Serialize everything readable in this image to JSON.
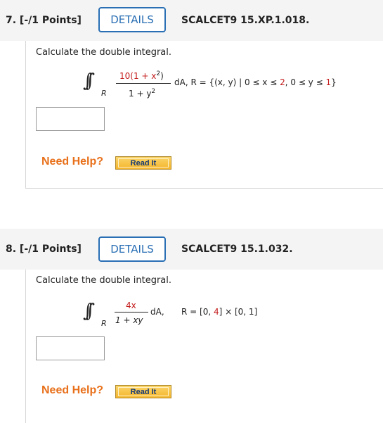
{
  "questions": [
    {
      "number": "7. [-/1 Points]",
      "details_label": "DETAILS",
      "code": "SCALCET9 15.XP.1.018.",
      "prompt": "Calculate the double integral.",
      "int_subscript": "R",
      "numerator_pre": "10(1 + x",
      "numerator_exp": "2",
      "numerator_post": ")",
      "denominator_pre": "1 + y",
      "denominator_exp": "2",
      "tail_pre": "dA, R = {(x, y) | 0 ≤ x ≤ ",
      "tail_red1": "2",
      "tail_mid": ", 0 ≤ y ≤ ",
      "tail_red2": "1",
      "tail_post": "}",
      "answer_value": "",
      "need_help": "Need Help?",
      "read_it": "Read It"
    },
    {
      "number": "8. [-/1 Points]",
      "details_label": "DETAILS",
      "code": "SCALCET9 15.1.032.",
      "prompt": "Calculate the double integral.",
      "int_subscript": "R",
      "numerator": "4x",
      "denominator": "1 + xy",
      "tail": "dA,",
      "region_pre": "R = [0, ",
      "region_red": "4",
      "region_post": "] × [0, 1]",
      "answer_value": "",
      "need_help": "Need Help?",
      "read_it": "Read It"
    }
  ]
}
